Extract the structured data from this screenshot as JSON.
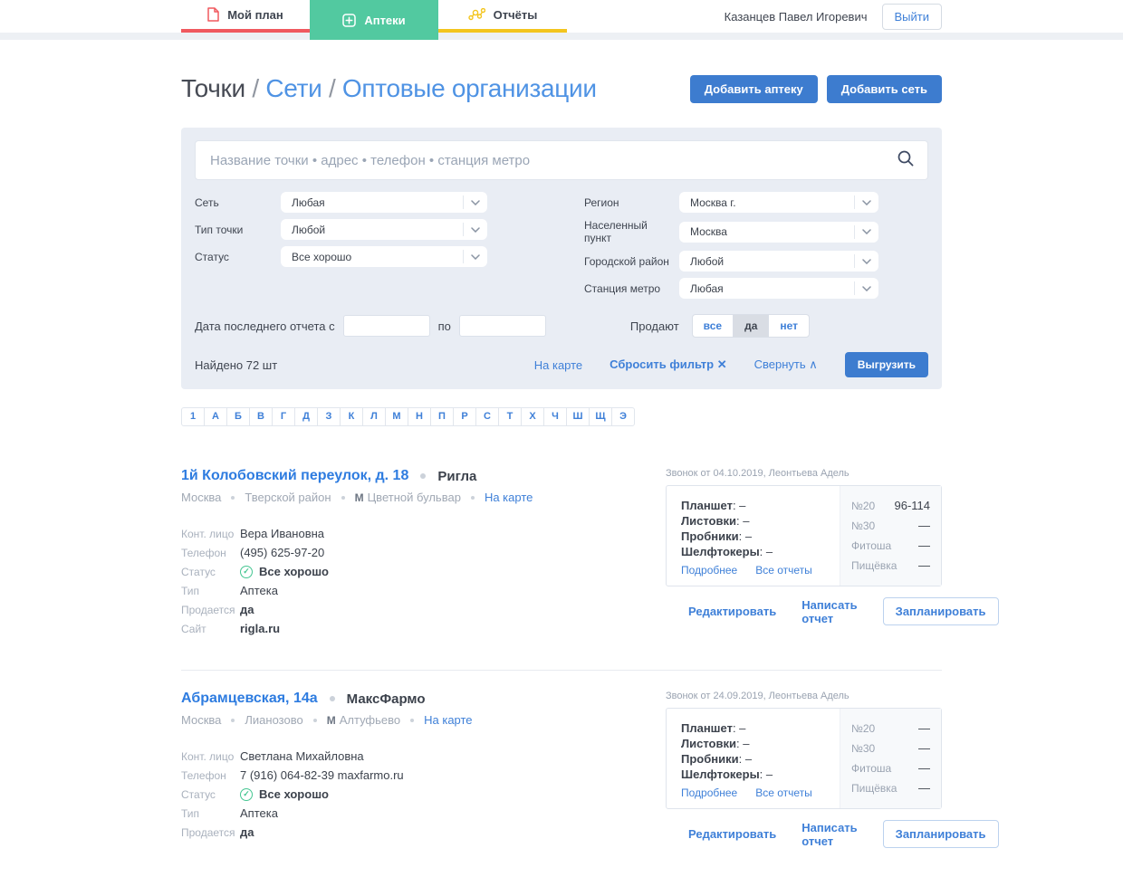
{
  "header": {
    "tabs": [
      {
        "label": "Мой план",
        "icon": "document-icon",
        "color": "#f0595f",
        "active": false
      },
      {
        "label": "Аптеки",
        "icon": "plus-icon",
        "color": "#52c9a0",
        "active": true
      },
      {
        "label": "Отчёты",
        "icon": "chart-icon",
        "color": "#f3c51e",
        "active": false
      }
    ],
    "user_name": "Казанцев Павел Игоревич",
    "logout_label": "Выйти"
  },
  "breadcrumb": {
    "current": "Точки",
    "separator": "/",
    "nets_link": "Сети",
    "wholesale_link": "Оптовые организации"
  },
  "actions": {
    "add_pharmacy": "Добавить аптеку",
    "add_network": "Добавить сеть"
  },
  "filters": {
    "search_placeholder": "Название точки • адрес • телефон • станция метро",
    "left": [
      {
        "label": "Сеть",
        "value": "Любая"
      },
      {
        "label": "Тип точки",
        "value": "Любой"
      },
      {
        "label": "Статус",
        "value": "Все хорошо"
      }
    ],
    "right": [
      {
        "label": "Регион",
        "value": "Москва г."
      },
      {
        "label": "Населенный пункт",
        "value": "Москва"
      },
      {
        "label": "Городской район",
        "value": "Любой"
      },
      {
        "label": "Станция метро",
        "value": "Любая"
      }
    ],
    "date_from_label": "Дата последнего отчета с",
    "date_between_label": "по",
    "date_from_value": "",
    "date_to_value": "",
    "sell_label": "Продают",
    "sell_options": [
      "все",
      "да",
      "нет"
    ],
    "sell_selected": "да",
    "found_text": "Найдено 72 шт",
    "map_link": "На карте",
    "reset_link": "Сбросить фильтр",
    "reset_icon": "✕",
    "collapse_link": "Свернуть",
    "collapse_icon": "∧",
    "export_button": "Выгрузить"
  },
  "alphabet": [
    "1",
    "А",
    "Б",
    "В",
    "Г",
    "Д",
    "З",
    "К",
    "Л",
    "М",
    "Н",
    "П",
    "Р",
    "С",
    "Т",
    "Х",
    "Ч",
    "Ш",
    "Щ",
    "Э"
  ],
  "card_links": {
    "details": "Подробнее",
    "all_reports": "Все отчеты"
  },
  "item_actions": {
    "edit": "Редактировать",
    "write_report": "Написать отчет",
    "schedule": "Запланировать"
  },
  "items": [
    {
      "title": "1й Колобовский переулок, д. 18",
      "network": "Ригла",
      "meta": {
        "city": "Москва",
        "district": "Тверской район",
        "metro": "Цветной бульвар",
        "map_link": "На карте"
      },
      "fields": [
        {
          "label": "Конт. лицо",
          "value": "Вера Ивановна",
          "bold": false,
          "check": false
        },
        {
          "label": "Телефон",
          "value": "(495) 625-97-20",
          "bold": false,
          "check": false
        },
        {
          "label": "Статус",
          "value": "Все хорошо",
          "bold": true,
          "check": true
        },
        {
          "label": "Тип",
          "value": "Аптека",
          "bold": false,
          "check": false
        },
        {
          "label": "Продается",
          "value": "да",
          "bold": true,
          "check": false
        },
        {
          "label": "Сайт",
          "value": "rigla.ru",
          "bold": true,
          "check": false
        }
      ],
      "call_info": "Звонок от 04.10.2019, Леонтьева Адель",
      "report": {
        "lines": [
          {
            "label": "Планшет",
            "value": "–"
          },
          {
            "label": "Листовки",
            "value": "–"
          },
          {
            "label": "Пробники",
            "value": "–"
          },
          {
            "label": "Шелфтокеры",
            "value": "–"
          }
        ],
        "stats": [
          {
            "label": "№20",
            "value": "96-114"
          },
          {
            "label": "№30",
            "value": "—"
          },
          {
            "label": "Фитоша",
            "value": "—"
          },
          {
            "label": "Пищёвка",
            "value": "—"
          }
        ]
      }
    },
    {
      "title": "Абрамцевская, 14а",
      "network": "МаксФармо",
      "meta": {
        "city": "Москва",
        "district": "Лианозово",
        "metro": "Алтуфьево",
        "map_link": "На карте"
      },
      "fields": [
        {
          "label": "Конт. лицо",
          "value": "Светлана Михайловна",
          "bold": false,
          "check": false
        },
        {
          "label": "Телефон",
          "value": "7 (916) 064-82-39 maxfarmo.ru",
          "bold": false,
          "check": false
        },
        {
          "label": "Статус",
          "value": "Все хорошо",
          "bold": true,
          "check": true
        },
        {
          "label": "Тип",
          "value": "Аптека",
          "bold": false,
          "check": false
        },
        {
          "label": "Продается",
          "value": "да",
          "bold": true,
          "check": false
        }
      ],
      "call_info": "Звонок от 24.09.2019, Леонтьева Адель",
      "report": {
        "lines": [
          {
            "label": "Планшет",
            "value": "–"
          },
          {
            "label": "Листовки",
            "value": "–"
          },
          {
            "label": "Пробники",
            "value": "–"
          },
          {
            "label": "Шелфтокеры",
            "value": "–"
          }
        ],
        "stats": [
          {
            "label": "№20",
            "value": "—"
          },
          {
            "label": "№30",
            "value": "—"
          },
          {
            "label": "Фитоша",
            "value": "—"
          },
          {
            "label": "Пищёвка",
            "value": "—"
          }
        ]
      }
    }
  ]
}
